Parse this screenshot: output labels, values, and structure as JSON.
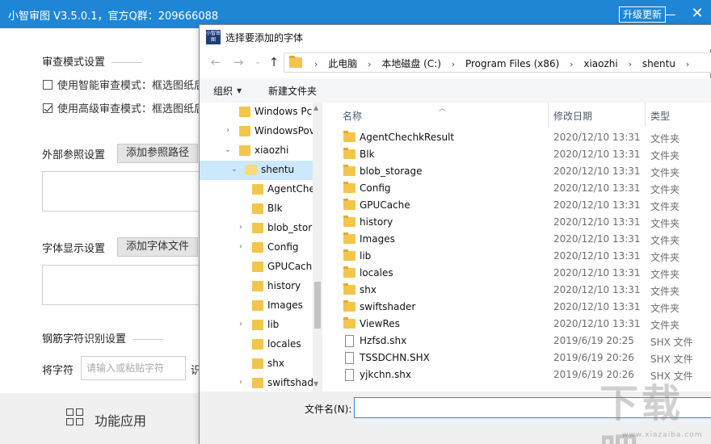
{
  "app": {
    "title": "小智审图 V3.5.0.1，官方Q群：209666088",
    "upgrade_label": "升级更新",
    "review_mode_title": "审查模式设置",
    "smart_mode_label": "使用智能审查模式：框选图纸后",
    "advanced_mode_label": "使用高级审查模式：框选图纸后",
    "smart_mode_checked": false,
    "advanced_mode_checked": true,
    "xref_label": "外部参照设置",
    "add_xref_label": "添加参照路径",
    "font_label": "字体显示设置",
    "add_font_label": "添加字体文件",
    "rebar_title": "钢筋字符识别设置",
    "char_label": "将字符",
    "char_placeholder": "请输入或粘贴字符",
    "recognize_fragment": "识",
    "func_label": "功能应用",
    "func_icon": "grid-icon"
  },
  "dialog": {
    "logo_text": "小智审图",
    "title": "选择要添加的字体",
    "breadcrumbs": [
      "此电脑",
      "本地磁盘 (C:)",
      "Program Files (x86)",
      "xiaozhi",
      "shentu"
    ],
    "organize_label": "组织",
    "new_folder_label": "新建文件夹",
    "tree": [
      {
        "label": "Windows Pc",
        "arrow": "",
        "expanded": false,
        "selected": false
      },
      {
        "label": "WindowsPov",
        "arrow": "›",
        "expanded": false,
        "selected": false
      },
      {
        "label": "xiaozhi",
        "arrow": "⌄",
        "expanded": true,
        "selected": false
      },
      {
        "label": "shentu",
        "arrow": "⌄",
        "expanded": true,
        "selected": true
      },
      {
        "label": "AgentChe",
        "arrow": "",
        "expanded": false,
        "selected": false
      },
      {
        "label": "Blk",
        "arrow": "",
        "expanded": false,
        "selected": false
      },
      {
        "label": "blob_stor",
        "arrow": "›",
        "expanded": false,
        "selected": false
      },
      {
        "label": "Config",
        "arrow": "›",
        "expanded": false,
        "selected": false
      },
      {
        "label": "GPUCach",
        "arrow": "",
        "expanded": false,
        "selected": false
      },
      {
        "label": "history",
        "arrow": "",
        "expanded": false,
        "selected": false
      },
      {
        "label": "Images",
        "arrow": "",
        "expanded": false,
        "selected": false
      },
      {
        "label": "lib",
        "arrow": "›",
        "expanded": false,
        "selected": false
      },
      {
        "label": "locales",
        "arrow": "",
        "expanded": false,
        "selected": false
      },
      {
        "label": "shx",
        "arrow": "",
        "expanded": false,
        "selected": false
      },
      {
        "label": "swiftshad",
        "arrow": "›",
        "expanded": false,
        "selected": false
      }
    ],
    "columns": {
      "name": "名称",
      "date": "修改日期",
      "type": "类型"
    },
    "files": [
      {
        "name": "AgentChechkResult",
        "date": "2020/12/10 13:31",
        "type": "文件夹",
        "kind": "folder"
      },
      {
        "name": "Blk",
        "date": "2020/12/10 13:31",
        "type": "文件夹",
        "kind": "folder"
      },
      {
        "name": "blob_storage",
        "date": "2020/12/10 13:31",
        "type": "文件夹",
        "kind": "folder"
      },
      {
        "name": "Config",
        "date": "2020/12/10 13:31",
        "type": "文件夹",
        "kind": "folder"
      },
      {
        "name": "GPUCache",
        "date": "2020/12/10 13:31",
        "type": "文件夹",
        "kind": "folder"
      },
      {
        "name": "history",
        "date": "2020/12/10 13:31",
        "type": "文件夹",
        "kind": "folder"
      },
      {
        "name": "Images",
        "date": "2020/12/10 13:31",
        "type": "文件夹",
        "kind": "folder"
      },
      {
        "name": "lib",
        "date": "2020/12/10 13:31",
        "type": "文件夹",
        "kind": "folder"
      },
      {
        "name": "locales",
        "date": "2020/12/10 13:31",
        "type": "文件夹",
        "kind": "folder"
      },
      {
        "name": "shx",
        "date": "2020/12/10 13:31",
        "type": "文件夹",
        "kind": "folder"
      },
      {
        "name": "swiftshader",
        "date": "2020/12/10 13:31",
        "type": "文件夹",
        "kind": "folder"
      },
      {
        "name": "ViewRes",
        "date": "2020/12/10 13:31",
        "type": "文件夹",
        "kind": "folder"
      },
      {
        "name": "Hzfsd.shx",
        "date": "2019/6/19 20:25",
        "type": "SHX 文件",
        "kind": "file"
      },
      {
        "name": "TSSDCHN.SHX",
        "date": "2019/6/19 20:26",
        "type": "SHX 文件",
        "kind": "file"
      },
      {
        "name": "yjkchn.shx",
        "date": "2019/6/19 20:26",
        "type": "SHX 文件",
        "kind": "file"
      }
    ],
    "filename_label": "文件名(N):",
    "filename_value": ""
  },
  "watermark": {
    "text": "下载吧",
    "sub": "www.xiazaiba.com"
  },
  "colors": {
    "titlebar": "#1f86d6",
    "selection": "#cce8ff",
    "folder": "#f3c54b"
  }
}
